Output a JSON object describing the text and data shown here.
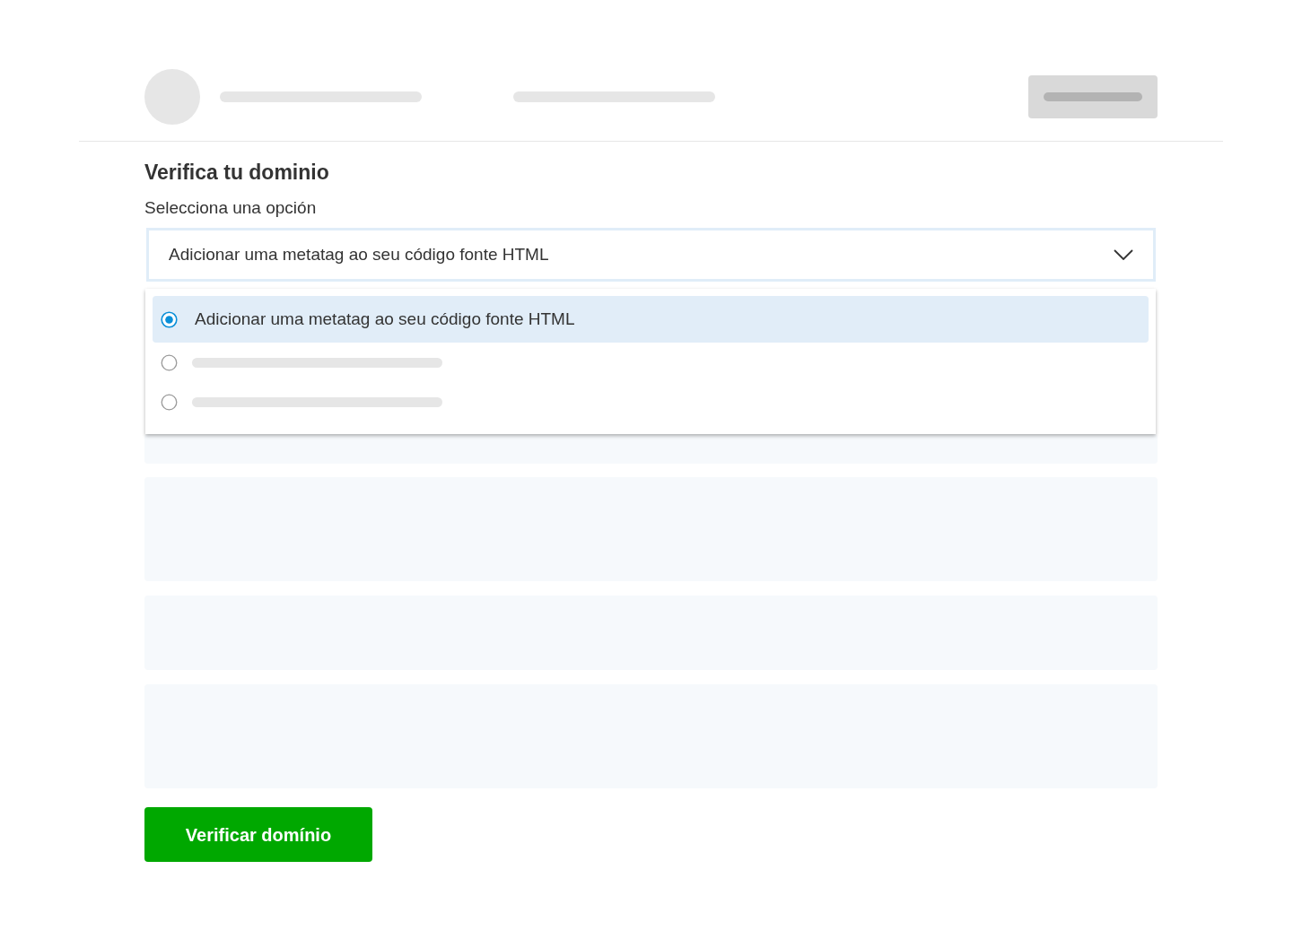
{
  "title": "Verifica tu dominio",
  "field_label": "Selecciona una opción",
  "select": {
    "value": "Adicionar uma metatag ao seu código fonte HTML",
    "expanded": true
  },
  "options": [
    {
      "label": "Adicionar uma metatag ao seu código fonte HTML",
      "selected": true
    },
    {
      "selected": false
    },
    {
      "selected": false
    }
  ],
  "submit_button": "Verificar domínio"
}
